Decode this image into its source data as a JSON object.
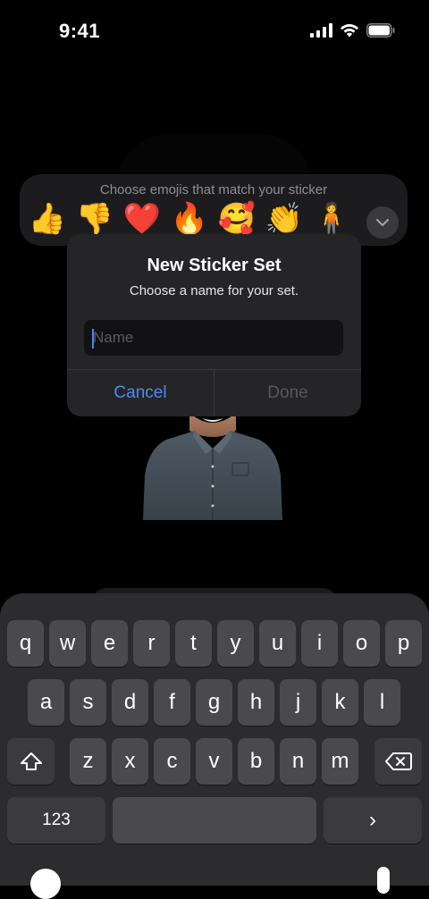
{
  "status_bar": {
    "time": "9:41"
  },
  "emoji_picker": {
    "hint": "Choose emojis that match your sticker",
    "emojis": [
      "👍",
      "👎",
      "❤️",
      "🔥",
      "🥰",
      "👏",
      "🧍"
    ]
  },
  "alert": {
    "title": "New Sticker Set",
    "subtitle": "Choose a name for your set.",
    "name_field": {
      "placeholder": "Name",
      "value": ""
    },
    "cancel_label": "Cancel",
    "done_label": "Done"
  },
  "keyboard": {
    "row1": [
      "q",
      "w",
      "e",
      "r",
      "t",
      "y",
      "u",
      "i",
      "o",
      "p"
    ],
    "row2": [
      "a",
      "s",
      "d",
      "f",
      "g",
      "h",
      "j",
      "k",
      "l"
    ],
    "row3": [
      "z",
      "x",
      "c",
      "v",
      "b",
      "n",
      "m"
    ],
    "numbers_label": "123",
    "return_label": "›"
  }
}
